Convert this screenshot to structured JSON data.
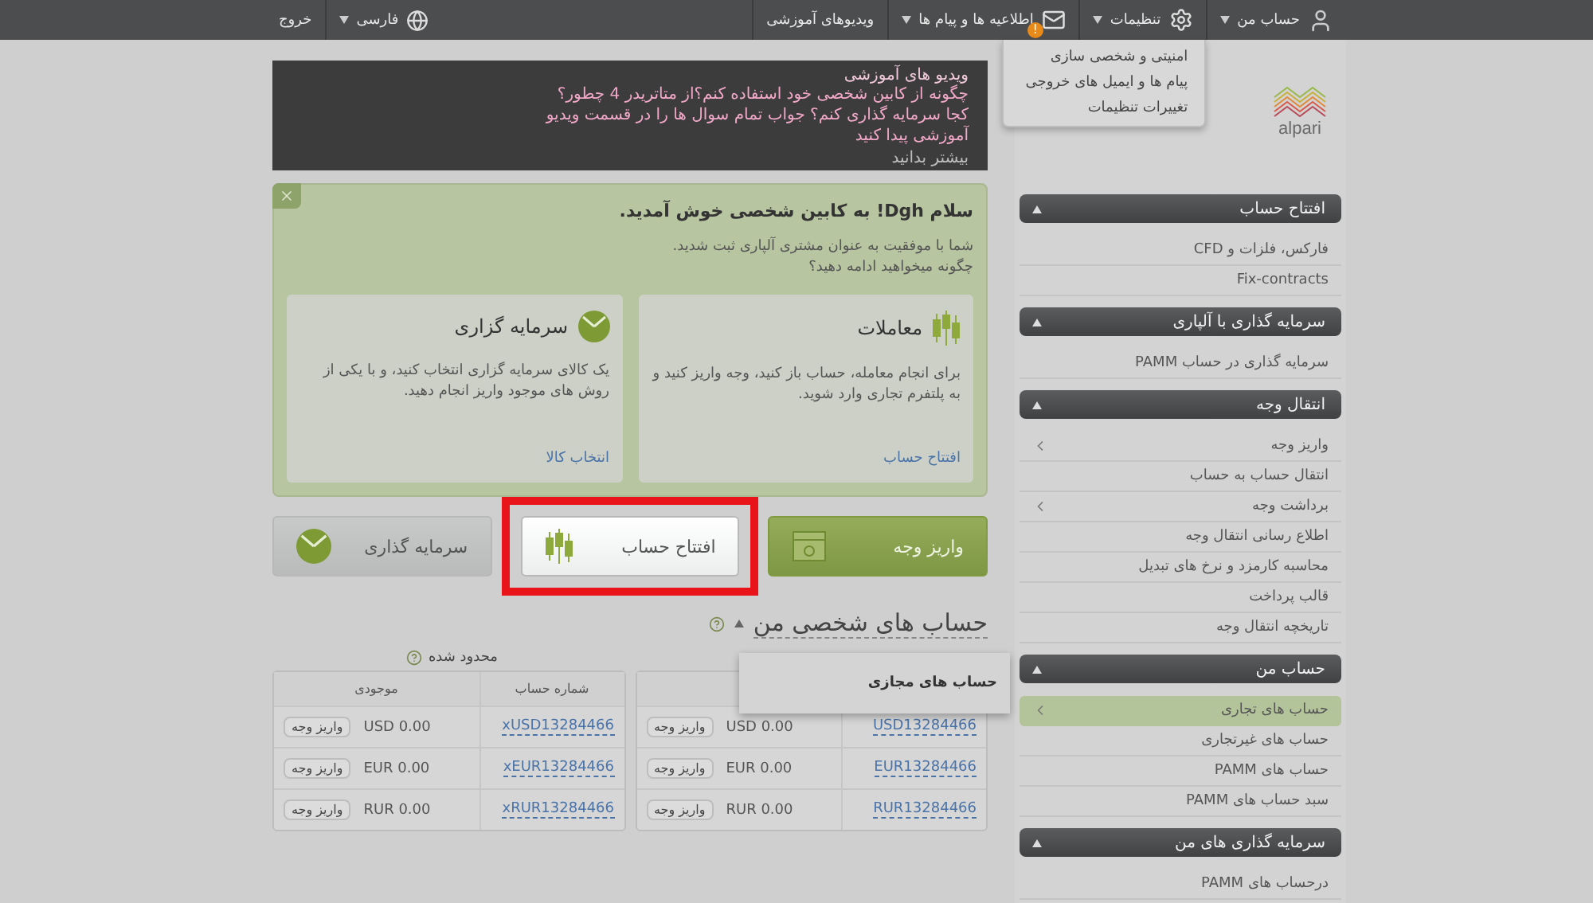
{
  "topbar": {
    "menu": [
      {
        "kind": "user",
        "label": "حساب من",
        "dropdown": true
      },
      {
        "kind": "settings",
        "label": "تنظیمات",
        "dropdown": true,
        "open": true
      },
      {
        "kind": "mail",
        "label": "اطلاعیه ها و پیام ها",
        "dropdown": true,
        "badge": "!"
      },
      {
        "kind": "plain",
        "label": "ویدیوهای آموزشی",
        "dropdown": false
      }
    ],
    "language": {
      "label": "فارسی"
    },
    "logout": "خروج"
  },
  "settings_menu": [
    "امنیتی و شخصی سازی",
    "پیام ها و ایمیل های خروجی",
    "تغییرات تنظیمات"
  ],
  "sidebar": {
    "logo": "alpari",
    "sections": [
      {
        "title": "افتتاح حساب",
        "expanded": true,
        "items": [
          {
            "label": "فارکس، فلزات و CFD",
            "submenu": false,
            "selected": false
          },
          {
            "label": "Fix-contracts",
            "submenu": false,
            "selected": false
          }
        ]
      },
      {
        "title": "سرمایه گذاری با آلپاری",
        "expanded": true,
        "items": [
          {
            "label": "سرمایه گذاری در حساب PAMM",
            "submenu": false,
            "selected": false
          }
        ]
      },
      {
        "title": "انتقال وجه",
        "expanded": true,
        "items": [
          {
            "label": "واریز وجه",
            "submenu": true,
            "selected": false
          },
          {
            "label": "انتقال حساب به حساب",
            "submenu": false,
            "selected": false
          },
          {
            "label": "برداشت وجه",
            "submenu": true,
            "selected": false
          },
          {
            "label": "اطلاع رسانی انتقال وجه",
            "submenu": false,
            "selected": false
          },
          {
            "label": "محاسبه کارمزد و نرخ های تبدیل",
            "submenu": false,
            "selected": false
          },
          {
            "label": "قالب پرداخت",
            "submenu": false,
            "selected": false
          },
          {
            "label": "تاریخچه انتقال وجه",
            "submenu": false,
            "selected": false
          }
        ]
      },
      {
        "title": "حساب من",
        "expanded": true,
        "items": [
          {
            "label": "حساب های تجاری",
            "submenu": true,
            "selected": true
          },
          {
            "label": "حساب های غیرتجاری",
            "submenu": false,
            "selected": false
          },
          {
            "label": "حساب های PAMM",
            "submenu": false,
            "selected": false
          },
          {
            "label": "سبد حساب های PAMM",
            "submenu": false,
            "selected": false
          }
        ]
      },
      {
        "title": "سرمایه گذاری های من",
        "expanded": true,
        "items": [
          {
            "label": "درحساب های PAMM",
            "submenu": false,
            "selected": false
          }
        ]
      }
    ]
  },
  "video_banner": {
    "title": "ویدیو های آموزشی",
    "lines": [
      "چگونه از کابین شخصی خود استفاده کنم؟از متاتریدر 4 چطور؟",
      "کجا سرمایه گذاری کنم؟ جواب تمام سوال ها را در قسمت ویدیو آموزشی پیدا کنید"
    ],
    "link": "بیشتر بدانید"
  },
  "welcome": {
    "title": "سلام Dgh! به کابین شخصی خوش آمدید.",
    "lines": [
      "شما با موفقیت به عنوان مشتری آلپاری ثبت شدید.",
      "چگونه میخواهید ادامه دهید؟"
    ],
    "cards": [
      {
        "kind": "trading",
        "title": "معاملات",
        "text": "برای انجام معامله، حساب باز کنید، وجه واریز کنید و به پلتفرم تجاری وارد شوید.",
        "link": "افتتاح حساب"
      },
      {
        "kind": "invest",
        "title": "سرمایه گزاری",
        "text": "یک کالای سرمایه گزاری انتخاب کنید، و با یکی از روش های موجود واریز انجام دهید.",
        "link": "انتخاب کالا"
      }
    ]
  },
  "actions": [
    {
      "kind": "deposit",
      "label": "واریز وجه",
      "highlighted": false
    },
    {
      "kind": "open",
      "label": "افتتاح حساب",
      "highlighted": true
    },
    {
      "kind": "invest",
      "label": "سرمایه گذاری",
      "highlighted": false
    }
  ],
  "accounts": {
    "title": "حساب های شخصی من",
    "popup": "حساب های مجازی",
    "tables": [
      {
        "rows": [
          {
            "account": "USD13284466",
            "balance": "USD 0.00",
            "action": "واریز وجه"
          },
          {
            "account": "EUR13284466",
            "balance": "EUR 0.00",
            "action": "واریز وجه"
          },
          {
            "account": "RUR13284466",
            "balance": "RUR 0.00",
            "action": "واریز وجه"
          }
        ]
      },
      {
        "caption": "محدود شده",
        "columns": [
          "شماره حساب",
          "موجودی"
        ],
        "rows": [
          {
            "account": "xUSD13284466",
            "balance": "USD 0.00",
            "action": "واریز وجه"
          },
          {
            "account": "xEUR13284466",
            "balance": "EUR 0.00",
            "action": "واریز وجه"
          },
          {
            "account": "xRUR13284466",
            "balance": "RUR 0.00",
            "action": "واریز وجه"
          }
        ]
      }
    ]
  }
}
